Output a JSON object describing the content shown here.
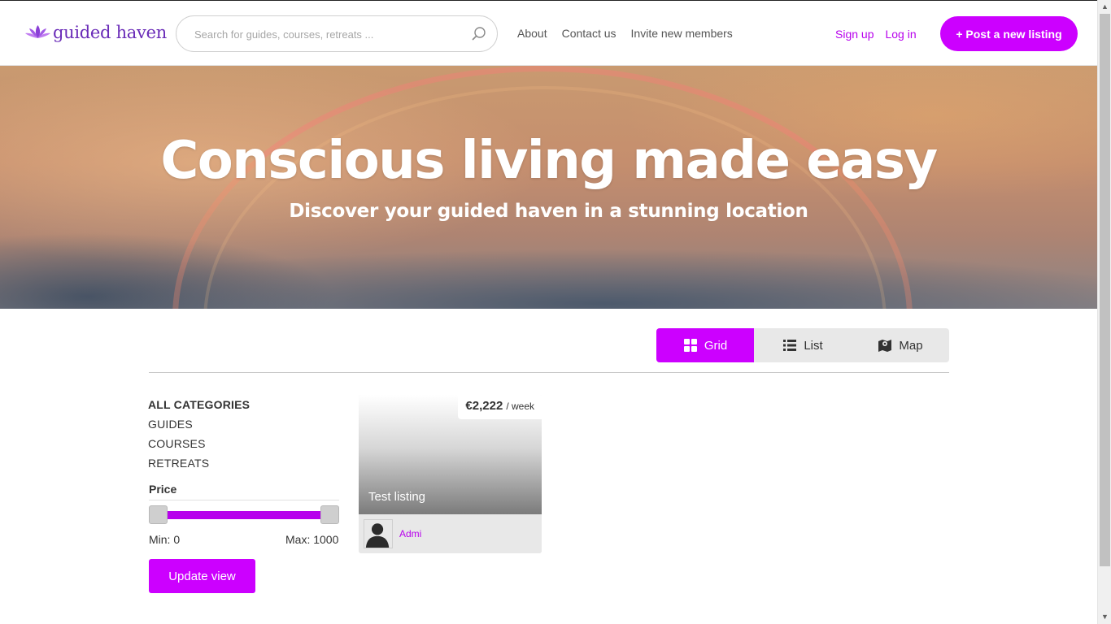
{
  "brand": {
    "name": "guided haven",
    "color": "#6a2cb8"
  },
  "accent": "#cc00ff",
  "search": {
    "placeholder": "Search for guides, courses, retreats ..."
  },
  "nav": {
    "about": "About",
    "contact": "Contact us",
    "invite": "Invite new members"
  },
  "auth": {
    "signup": "Sign up",
    "login": "Log in"
  },
  "post_button": "+ Post a new listing",
  "hero": {
    "title": "Conscious living made easy",
    "subtitle": "Discover your guided haven in a stunning location"
  },
  "view_toggle": {
    "grid": "Grid",
    "list": "List",
    "map": "Map",
    "active": "grid"
  },
  "categories": [
    "ALL CATEGORIES",
    "GUIDES",
    "COURSES",
    "RETREATS"
  ],
  "price_filter": {
    "title": "Price",
    "min_label": "Min: 0",
    "max_label": "Max: 1000",
    "min": 0,
    "max": 1000
  },
  "update_button": "Update view",
  "listing": {
    "price": "€2,222",
    "unit": "/ week",
    "title": "Test listing",
    "author": "Admi"
  },
  "icons": {
    "search": "search-icon",
    "grid": "grid-icon",
    "list": "list-icon",
    "map": "map-icon",
    "logo": "lotus-icon",
    "avatar": "person-icon"
  }
}
